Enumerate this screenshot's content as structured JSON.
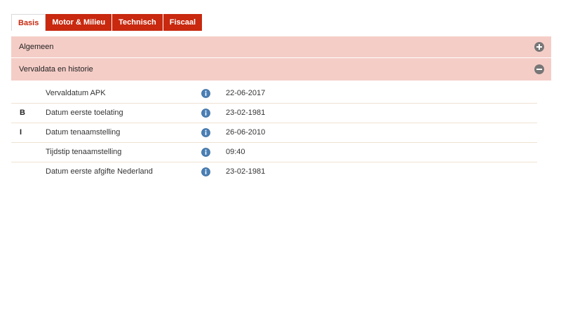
{
  "tabs": [
    {
      "label": "Basis",
      "active": true
    },
    {
      "label": "Motor & Milieu",
      "active": false
    },
    {
      "label": "Technisch",
      "active": false
    },
    {
      "label": "Fiscaal",
      "active": false
    }
  ],
  "sections": [
    {
      "title": "Algemeen",
      "state": "collapsed",
      "toggle_icon": "plus-circle-icon"
    },
    {
      "title": "Vervaldata en historie",
      "state": "expanded",
      "toggle_icon": "minus-circle-icon"
    }
  ],
  "rows": [
    {
      "code": "",
      "label": "Vervaldatum APK",
      "value": "22-06-2017",
      "icon": "info-icon"
    },
    {
      "code": "B",
      "label": "Datum eerste toelating",
      "value": "23-02-1981",
      "icon": "info-icon"
    },
    {
      "code": "I",
      "label": "Datum tenaamstelling",
      "value": "26-06-2010",
      "icon": "info-icon"
    },
    {
      "code": "",
      "label": "Tijdstip tenaamstelling",
      "value": "09:40",
      "icon": "info-icon"
    },
    {
      "code": "",
      "label": "Datum eerste afgifte Nederland",
      "value": "23-02-1981",
      "icon": "info-icon"
    }
  ],
  "colors": {
    "accent": "#c8290f",
    "section_bg": "#f5cdc7",
    "toggle_icon": "#777777",
    "info_icon": "#4a7fb5",
    "row_divider": "#efe3d2"
  }
}
